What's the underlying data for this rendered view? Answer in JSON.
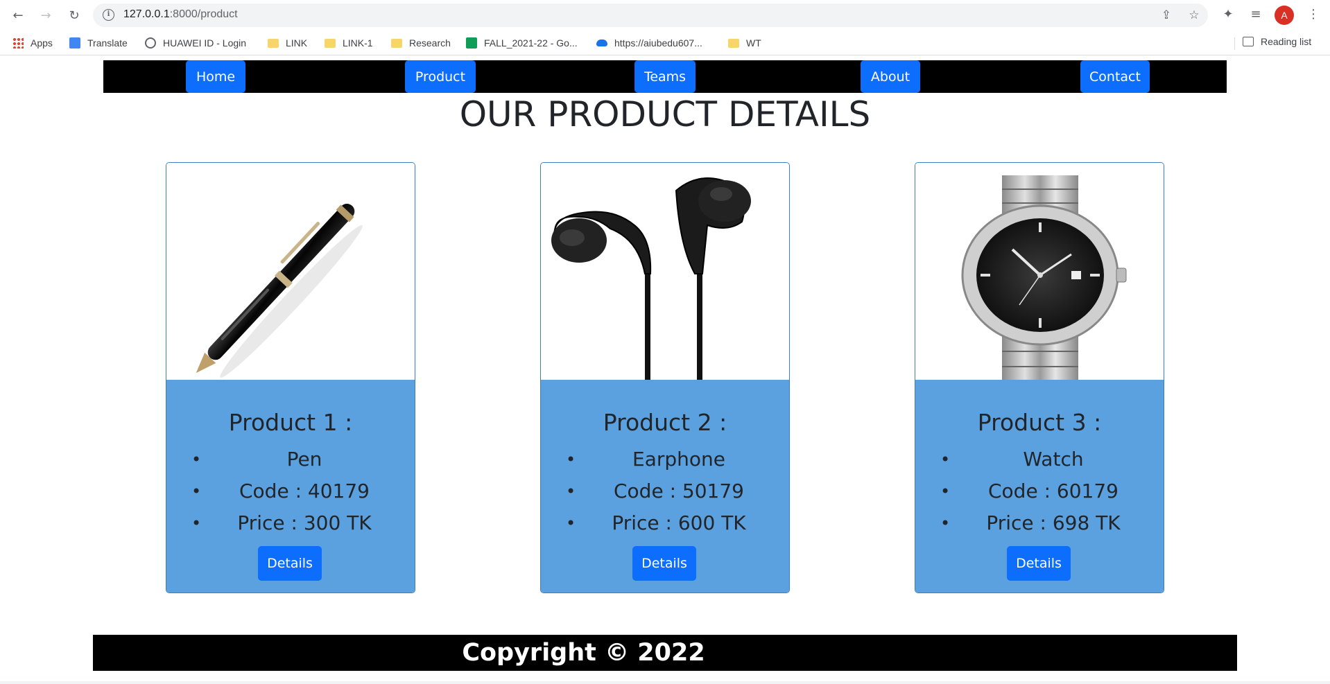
{
  "browser": {
    "url_host": "127.0.0.1",
    "url_path": ":8000/product",
    "avatar_letter": "A",
    "bookmarks": [
      {
        "label": "Apps",
        "icon": "apps-grid-icon"
      },
      {
        "label": "Translate",
        "icon": "google-translate-icon"
      },
      {
        "label": "HUAWEI ID - Login",
        "icon": "globe-icon"
      },
      {
        "label": "LINK",
        "icon": "folder-icon"
      },
      {
        "label": "LINK-1",
        "icon": "folder-icon"
      },
      {
        "label": "Research",
        "icon": "folder-icon"
      },
      {
        "label": "FALL_2021-22 - Go...",
        "icon": "sheets-icon"
      },
      {
        "label": "https://aiubedu607...",
        "icon": "onedrive-icon"
      },
      {
        "label": "WT",
        "icon": "folder-icon"
      }
    ],
    "reading_list": "Reading list"
  },
  "nav": {
    "items": [
      {
        "label": "Home"
      },
      {
        "label": "Product"
      },
      {
        "label": "Teams"
      },
      {
        "label": "About"
      },
      {
        "label": "Contact"
      }
    ]
  },
  "page": {
    "title": "OUR PRODUCT DETAILS"
  },
  "products": [
    {
      "title": "Product 1 :",
      "name": "Pen",
      "code": "Code : 40179",
      "price": "Price : 300 TK",
      "button": "Details",
      "image": "pen"
    },
    {
      "title": "Product 2 :",
      "name": "Earphone",
      "code": "Code : 50179",
      "price": "Price : 600 TK",
      "button": "Details",
      "image": "earphone"
    },
    {
      "title": "Product 3 :",
      "name": "Watch",
      "code": "Code : 60179",
      "price": "Price : 698 TK",
      "button": "Details",
      "image": "watch"
    }
  ],
  "footer": {
    "copyright": "Copyright © 2022"
  },
  "colors": {
    "nav_bg": "#000000",
    "button_blue": "#0d6efd",
    "card_body": "#5ba1df",
    "text_dark": "#212529"
  }
}
